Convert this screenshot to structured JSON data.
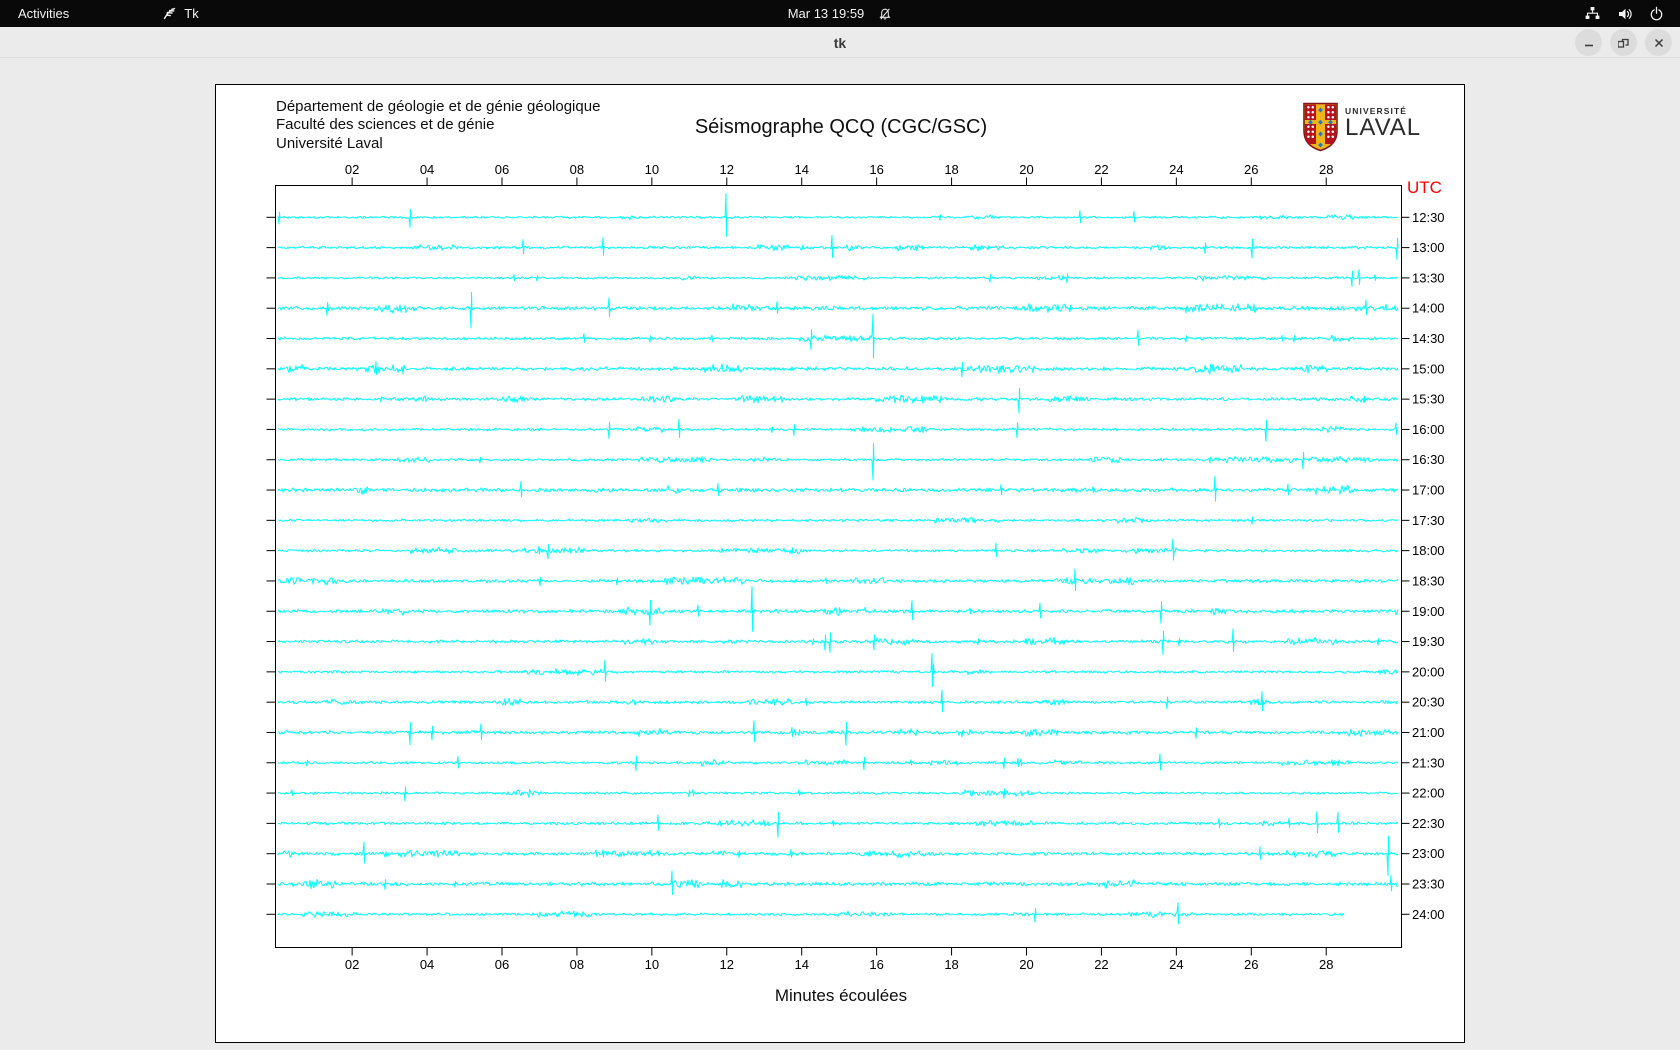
{
  "topbar": {
    "activities_label": "Activities",
    "app_name": "Tk",
    "clock": "Mar 13 19:59"
  },
  "window": {
    "title": "tk"
  },
  "header": {
    "address_lines": [
      "Département de géologie et de génie géologique",
      "Faculté des sciences et de génie",
      "Université Laval"
    ],
    "title": "Séismographe QCQ (CGC/GSC)",
    "logo": {
      "line_small": "UNIVERSITÉ",
      "line_large": "LAVAL"
    }
  },
  "chart_data": {
    "type": "line",
    "subtype": "helicorder_seismogram",
    "title": "Séismographe QCQ (CGC/GSC)",
    "xlabel": "Minutes écoulées",
    "right_axis_title": "UTC",
    "right_axis_title_color": "#ff0000",
    "trace_color": "#00ffff",
    "axis_color": "#000000",
    "x_range_minutes": [
      0,
      30
    ],
    "x_ticks": [
      "02",
      "04",
      "06",
      "08",
      "10",
      "12",
      "14",
      "16",
      "18",
      "20",
      "22",
      "24",
      "26",
      "28"
    ],
    "row_labels_utc": [
      "12:30",
      "13:00",
      "13:30",
      "14:00",
      "14:30",
      "15:00",
      "15:30",
      "16:00",
      "16:30",
      "17:00",
      "17:30",
      "18:00",
      "18:30",
      "19:00",
      "19:30",
      "20:00",
      "20:30",
      "21:00",
      "21:30",
      "22:00",
      "22:30",
      "23:00",
      "23:30",
      "24:00"
    ],
    "minutes_per_row": 30,
    "last_row_recorded_until_minute": 28.6,
    "grid": false,
    "legend": "none"
  }
}
